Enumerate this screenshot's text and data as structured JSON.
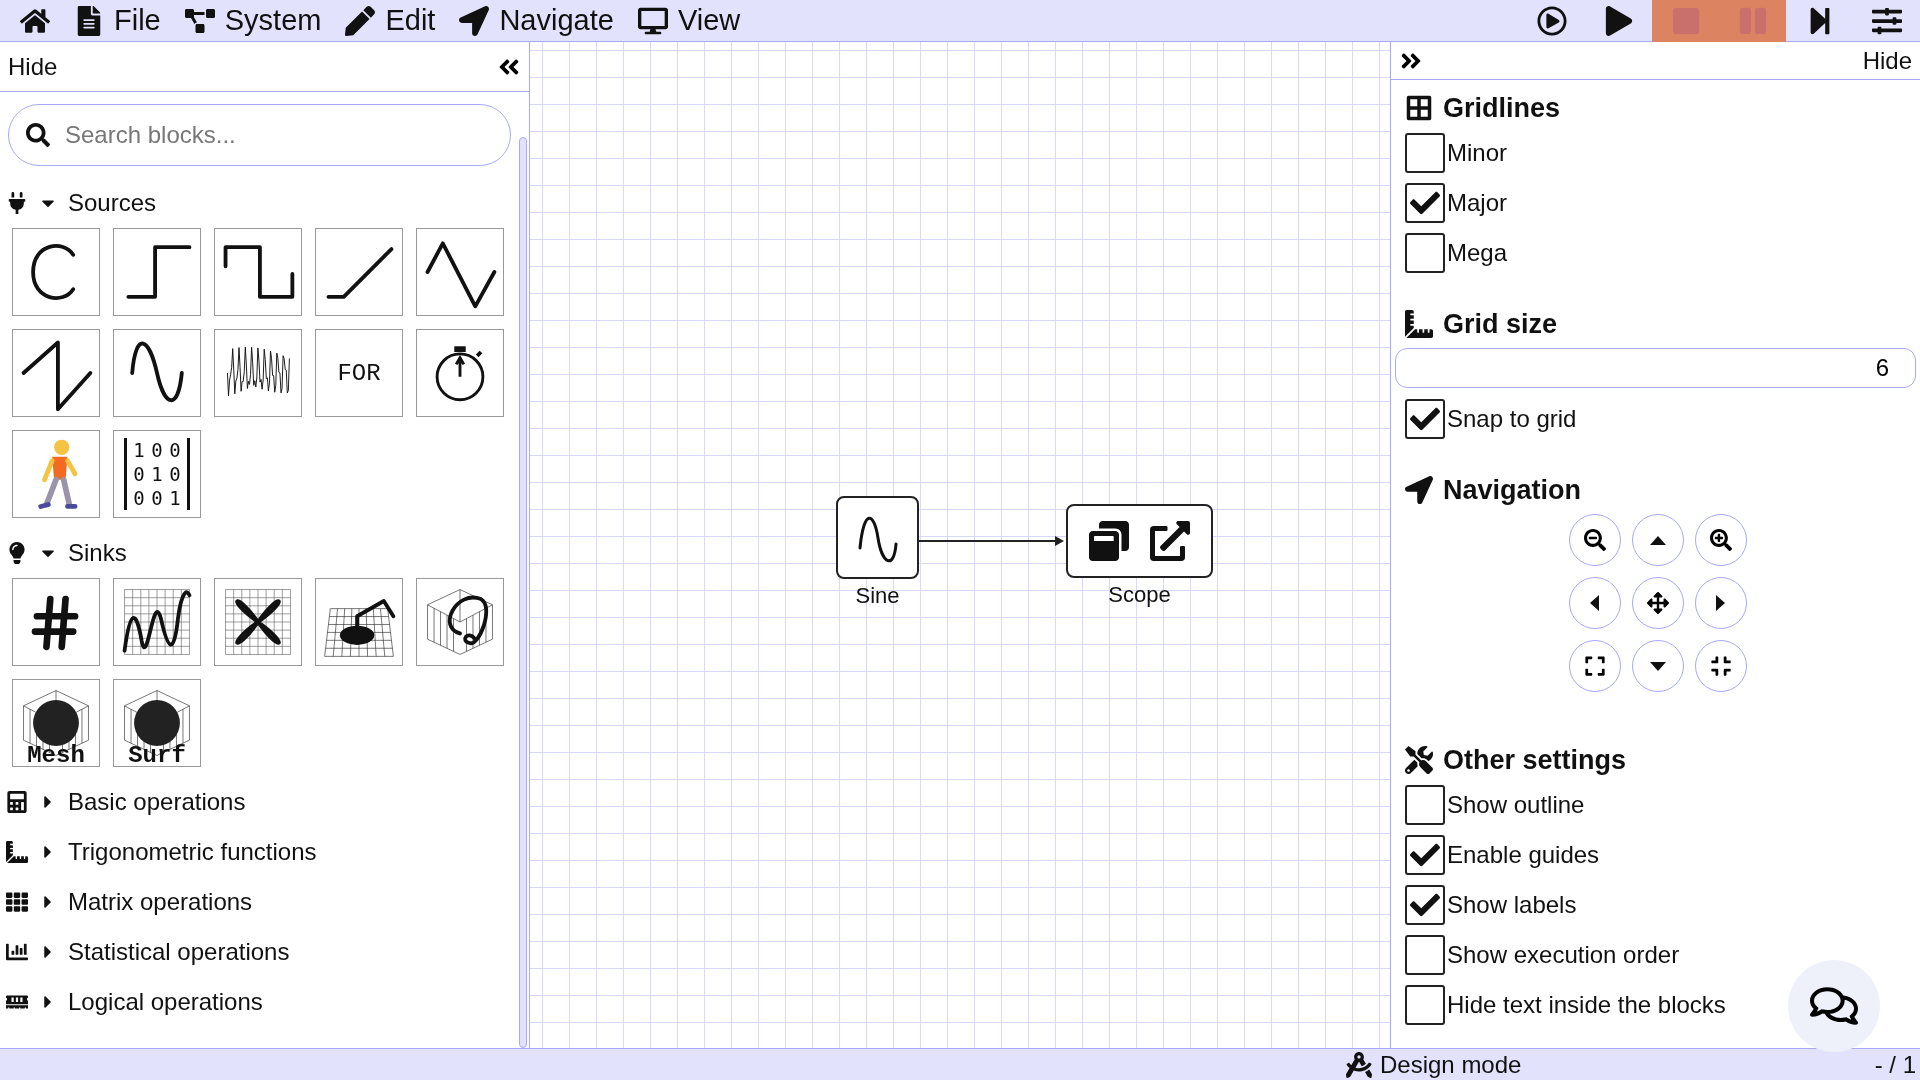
{
  "menubar": {
    "items": [
      {
        "kind": "home"
      },
      {
        "kind": "file",
        "label": "File"
      },
      {
        "kind": "system",
        "label": "System"
      },
      {
        "kind": "edit",
        "label": "Edit"
      },
      {
        "kind": "navigate",
        "label": "Navigate"
      },
      {
        "kind": "view",
        "label": "View"
      }
    ],
    "tools": [
      {
        "kind": "run",
        "disabled": false
      },
      {
        "kind": "play",
        "disabled": false
      },
      {
        "kind": "stop",
        "disabled": true
      },
      {
        "kind": "pause",
        "disabled": true
      },
      {
        "kind": "step",
        "disabled": false
      },
      {
        "kind": "settings",
        "disabled": false
      }
    ]
  },
  "left_panel": {
    "hide_label": "Hide",
    "search": {
      "placeholder": "Search blocks..."
    },
    "categories": [
      {
        "kind": "sources",
        "label": "Sources",
        "expanded": true,
        "blocks": [
          {
            "kind": "constant"
          },
          {
            "kind": "step"
          },
          {
            "kind": "pulse"
          },
          {
            "kind": "ramp"
          },
          {
            "kind": "triangle"
          },
          {
            "kind": "sawtooth"
          },
          {
            "kind": "sine"
          },
          {
            "kind": "noise"
          },
          {
            "kind": "for",
            "label": "FOR"
          },
          {
            "kind": "clock"
          },
          {
            "kind": "walker"
          },
          {
            "kind": "matrix",
            "rows": [
              [
                "1",
                "0",
                "0"
              ],
              [
                "0",
                "1",
                "0"
              ],
              [
                "0",
                "0",
                "1"
              ]
            ]
          }
        ]
      },
      {
        "kind": "sinks",
        "label": "Sinks",
        "expanded": true,
        "blocks": [
          {
            "kind": "display"
          },
          {
            "kind": "plot"
          },
          {
            "kind": "xy"
          },
          {
            "kind": "plot3d"
          },
          {
            "kind": "curve3d"
          },
          {
            "kind": "mesh",
            "label": "Mesh"
          },
          {
            "kind": "mesh",
            "label": "Surf"
          }
        ]
      },
      {
        "kind": "basic",
        "label": "Basic operations",
        "expanded": false
      },
      {
        "kind": "trig",
        "label": "Trigonometric functions",
        "expanded": false
      },
      {
        "kind": "matrix",
        "label": "Matrix operations",
        "expanded": false
      },
      {
        "kind": "stats",
        "label": "Statistical operations",
        "expanded": false
      },
      {
        "kind": "logic",
        "label": "Logical operations",
        "expanded": false
      }
    ]
  },
  "canvas": {
    "blocks": [
      {
        "kind": "sine",
        "label": "Sine"
      },
      {
        "kind": "scope",
        "label": "Scope"
      }
    ]
  },
  "right_panel": {
    "hide_label": "Hide",
    "sections": [
      {
        "kind": "gridlines",
        "title": "Gridlines",
        "items": [
          {
            "kind": "checkbox",
            "label": "Minor",
            "checked": false
          },
          {
            "kind": "checkbox",
            "label": "Major",
            "checked": true
          },
          {
            "kind": "checkbox",
            "label": "Mega",
            "checked": false
          }
        ]
      },
      {
        "kind": "gridsize",
        "title": "Grid size",
        "items": [
          {
            "kind": "number",
            "value": "6"
          },
          {
            "kind": "checkbox",
            "label": "Snap to grid",
            "checked": true
          }
        ]
      },
      {
        "kind": "navigation",
        "title": "Navigation",
        "items": [
          {
            "kind": "zoom-out"
          },
          {
            "kind": "up"
          },
          {
            "kind": "zoom-in"
          },
          {
            "kind": "left"
          },
          {
            "kind": "pan"
          },
          {
            "kind": "right"
          },
          {
            "kind": "fit"
          },
          {
            "kind": "down"
          },
          {
            "kind": "shrink"
          }
        ]
      },
      {
        "kind": "other",
        "title": "Other settings",
        "items": [
          {
            "kind": "checkbox",
            "label": "Show outline",
            "checked": false
          },
          {
            "kind": "checkbox",
            "label": "Enable guides",
            "checked": true
          },
          {
            "kind": "checkbox",
            "label": "Show labels",
            "checked": true
          },
          {
            "kind": "checkbox",
            "label": "Show execution order",
            "checked": false
          },
          {
            "kind": "checkbox",
            "label": "Hide text inside the blocks",
            "checked": false
          }
        ]
      }
    ]
  },
  "status_bar": {
    "mode": "Design mode",
    "page": "- / 1"
  }
}
